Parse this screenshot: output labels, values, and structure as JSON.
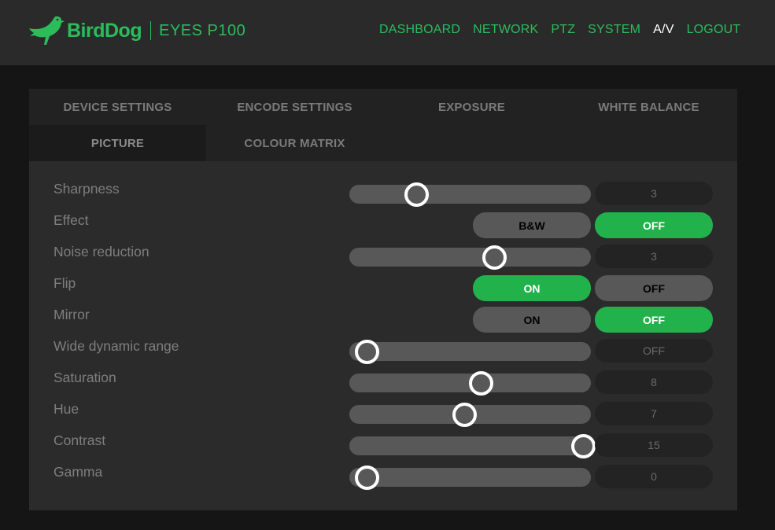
{
  "header": {
    "brand": "BirdDog",
    "model": "EYES P100",
    "nav": [
      {
        "label": "DASHBOARD",
        "active": false
      },
      {
        "label": "NETWORK",
        "active": false
      },
      {
        "label": "PTZ",
        "active": false
      },
      {
        "label": "SYSTEM",
        "active": false
      },
      {
        "label": "A/V",
        "active": true
      },
      {
        "label": "LOGOUT",
        "active": false
      }
    ]
  },
  "tabs": [
    {
      "label": "DEVICE SETTINGS",
      "active": false
    },
    {
      "label": "ENCODE SETTINGS",
      "active": false
    },
    {
      "label": "EXPOSURE",
      "active": false
    },
    {
      "label": "WHITE BALANCE",
      "active": false
    },
    {
      "label": "PICTURE",
      "active": true
    },
    {
      "label": "COLOUR MATRIX",
      "active": false
    }
  ],
  "settings": {
    "sharpness": {
      "label": "Sharpness",
      "value": "3",
      "level": 0.232
    },
    "effect": {
      "label": "Effect",
      "options": [
        "B&W",
        "OFF"
      ],
      "selected": "OFF"
    },
    "noise": {
      "label": "Noise reduction",
      "value": "3",
      "level": 0.592
    },
    "flip": {
      "label": "Flip",
      "options": [
        "ON",
        "OFF"
      ],
      "selected": "ON"
    },
    "mirror": {
      "label": "Mirror",
      "options": [
        "ON",
        "OFF"
      ],
      "selected": "OFF"
    },
    "wdr": {
      "label": "Wide dynamic range",
      "value": "OFF",
      "level": 0.0
    },
    "saturation": {
      "label": "Saturation",
      "value": "8",
      "level": 0.53
    },
    "hue": {
      "label": "Hue",
      "value": "7",
      "level": 0.452
    },
    "contrast": {
      "label": "Contrast",
      "value": "15",
      "level": 1.0
    },
    "gamma": {
      "label": "Gamma",
      "value": "0",
      "level": 0.0
    }
  },
  "colors": {
    "accent": "#22b24c",
    "brand": "#2bbd5a",
    "track": "#585858"
  }
}
